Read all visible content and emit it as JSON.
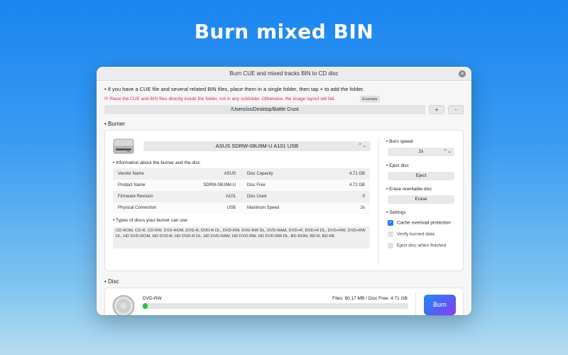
{
  "hero": {
    "title": "Burn mixed BIN"
  },
  "window": {
    "title": "Burn CUE and mixed tracks BIN to CD disc"
  },
  "instructions": {
    "text": "• If you have a CUE file and several related BIN files, place them in a single folder, then tap + to add the folder.",
    "warning": "!!! Place the CUE and BIN files directly inside the folder, not in any subfolder. Otherwise, the image layout will fail.",
    "example_label": "Example"
  },
  "folder": {
    "path": "/Users/os/Desktop/Battle Crust",
    "add_label": "+",
    "remove_label": "-"
  },
  "burner": {
    "section_title": "Burner",
    "selected": "ASUS SDRW-08U9M-U A101 USB",
    "info_title": "Information about the burner and the disc",
    "info_rows": [
      {
        "label": "Vendor Name",
        "value": "ASUS",
        "label2": "Disc Capacity",
        "value2": "4.71 GB"
      },
      {
        "label": "Product Name",
        "value": "SDRW-08U9M-U",
        "label2": "Disc Free",
        "value2": "4.71 GB"
      },
      {
        "label": "Firmware Revision",
        "value": "A101",
        "label2": "Disc Used",
        "value2": "0"
      },
      {
        "label": "Physical Connection",
        "value": "USB",
        "label2": "Maximum Speed",
        "value2": "2x"
      }
    ],
    "types_title": "Types of discs your burner can use",
    "types_text": "CD-ROM, CD-R, CD-RW, DVD-ROM, DVD-R, DVD-R DL, DVD-RW, DVD-RW DL, DVD-RAM, DVD+R, DVD+R DL, DVD+RW, DVD+RW DL, HD DVD-ROM, HD DVD-R, HD DVD-R DL, HD DVD-RAM, HD DVD-RW, HD DVD-RW DL, BD-ROM, BD-R, BD-RE"
  },
  "controls": {
    "burn_speed_label": "Burn speed",
    "burn_speed_value": "2x",
    "eject_label": "Eject disc",
    "eject_button": "Eject",
    "erase_label": "Erase rewritable disc",
    "erase_button": "Erase",
    "settings_label": "Settings",
    "settings": [
      {
        "label": "Cache overload protection",
        "checked": true
      },
      {
        "label": "Verify burned data",
        "checked": false
      },
      {
        "label": "Eject disc when finished",
        "checked": false
      }
    ]
  },
  "disc": {
    "section_title": "Disc",
    "type": "DVD-RW",
    "files_info": "Files: 90.17 MB / Disc Free: 4.71 GB",
    "progress_fraction": 0.019,
    "burn_label": "Burn"
  },
  "colors": {
    "accent": "#1f7cf1",
    "warning": "#e3264a",
    "progress": "#31c14a",
    "burn_gradient_start": "#1e8cf0",
    "burn_gradient_end": "#8a3df2"
  }
}
